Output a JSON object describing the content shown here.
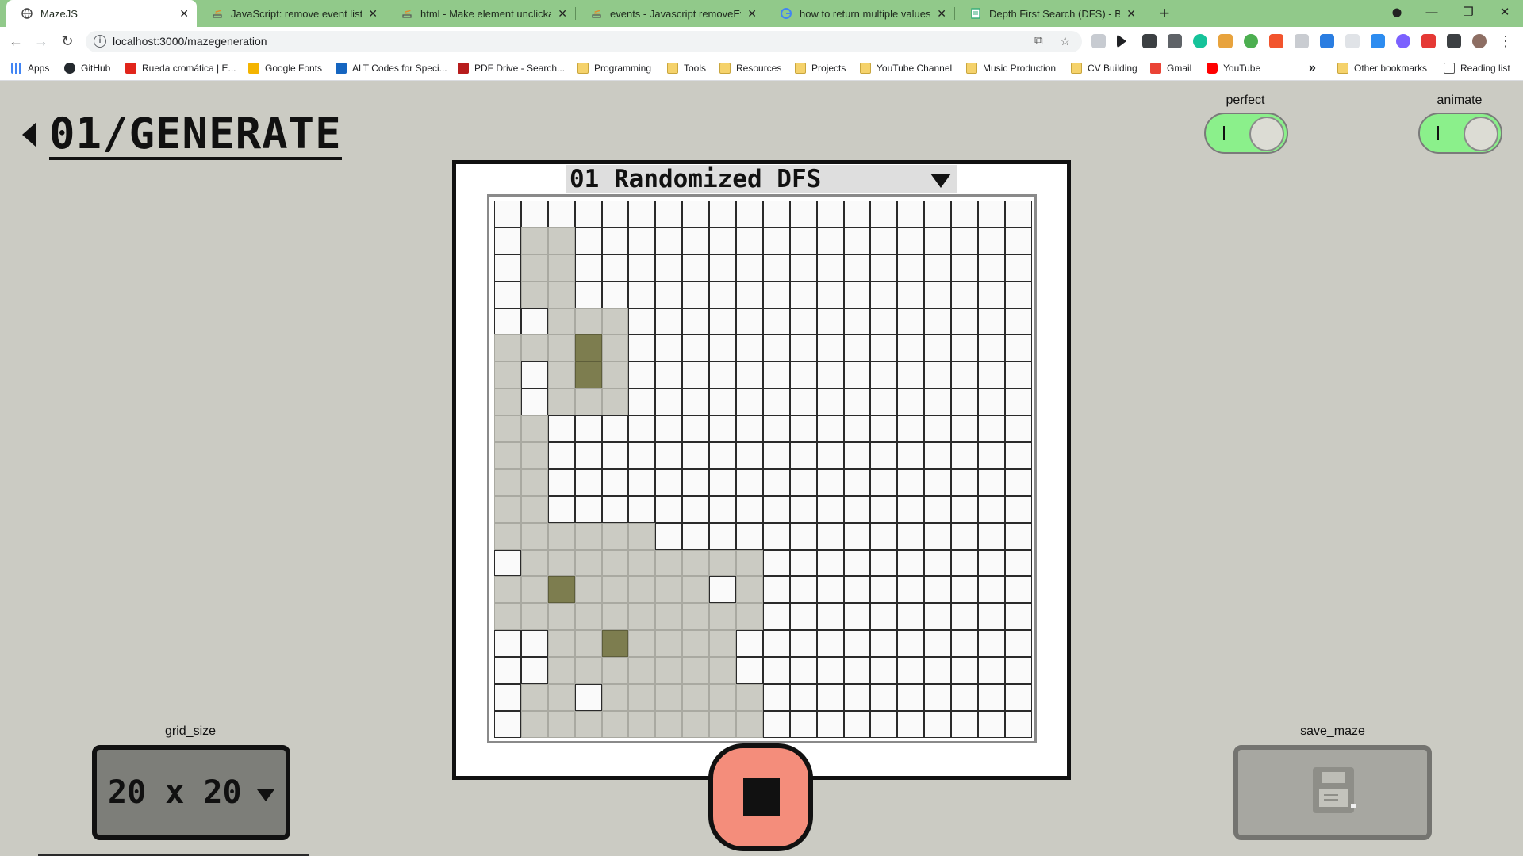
{
  "browser": {
    "tabs": [
      {
        "title": "MazeJS",
        "active": true,
        "icon": "globe-icon"
      },
      {
        "title": "JavaScript: remove event listener",
        "active": false,
        "icon": "stackoverflow-icon"
      },
      {
        "title": "html - Make element unclickable",
        "active": false,
        "icon": "stackoverflow-icon"
      },
      {
        "title": "events - Javascript removeEventL",
        "active": false,
        "icon": "stackoverflow-icon"
      },
      {
        "title": "how to return multiple values in",
        "active": false,
        "icon": "google-icon"
      },
      {
        "title": "Depth First Search (DFS) - Backtr",
        "active": false,
        "icon": "document-icon"
      }
    ],
    "url": "localhost:3000/mazegeneration",
    "bookmarks": [
      {
        "label": "Apps",
        "icon": "apps-grid-icon"
      },
      {
        "label": "GitHub",
        "icon": "github-icon"
      },
      {
        "label": "Rueda cromática | E...",
        "icon": "adobe-icon"
      },
      {
        "label": "Google Fonts",
        "icon": "google-fonts-icon"
      },
      {
        "label": "ALT Codes for Speci...",
        "icon": "alt-codes-icon"
      },
      {
        "label": "PDF Drive - Search...",
        "icon": "pdf-drive-icon"
      },
      {
        "label": "Programming",
        "icon": "folder-icon"
      },
      {
        "label": "Tools",
        "icon": "folder-icon"
      },
      {
        "label": "Resources",
        "icon": "folder-icon"
      },
      {
        "label": "Projects",
        "icon": "folder-icon"
      },
      {
        "label": "YouTube Channel",
        "icon": "folder-icon"
      },
      {
        "label": "Music Production",
        "icon": "folder-icon"
      },
      {
        "label": "CV Building",
        "icon": "folder-icon"
      },
      {
        "label": "Gmail",
        "icon": "gmail-icon"
      },
      {
        "label": "YouTube",
        "icon": "youtube-icon"
      }
    ],
    "overflow_label": "»",
    "other_bookmarks": "Other bookmarks",
    "reading_list": "Reading list"
  },
  "app": {
    "title": "01/GENERATE",
    "toggles": [
      {
        "label": "perfect",
        "on": true,
        "mark": "I"
      },
      {
        "label": "animate",
        "on": true,
        "mark": "I"
      }
    ],
    "algorithm": {
      "selected": "01 Randomized DFS"
    },
    "grid_size": {
      "label": "grid_size",
      "selected": "20 x 20"
    },
    "save": {
      "label": "save_maze",
      "icon": "floppy-disk-icon"
    },
    "stop": {
      "icon": "stop-icon"
    },
    "colors": {
      "accent_toggle": "#8bf08b",
      "stop_button": "#f48d7b",
      "visited_cell": "#cbcbc3",
      "head_cell": "#7d7d4f",
      "unvisited_cell": "#fafafa"
    }
  },
  "maze": {
    "rows": 20,
    "cols": 20,
    "legend": "v = visited, h = active head, . = unvisited",
    "cells": [
      "....................",
      ".vv.................",
      ".vv.................",
      ".vv.................",
      "..vvv...............",
      "vvvhv...............",
      "v.vhv...............",
      "v.vvv...............",
      "vv..................",
      "vv..................",
      "vv..................",
      "vv..................",
      "vvvvvv..............",
      ".vvvvvvvvv..........",
      "vvhvvvvv.v..........",
      "vvvvvvvvvv..........",
      "..vvhvvvv...........",
      "..vvvvvvv...........",
      ".vv.vvvvvv..........",
      ".vvvvvvvvv.........."
    ]
  }
}
